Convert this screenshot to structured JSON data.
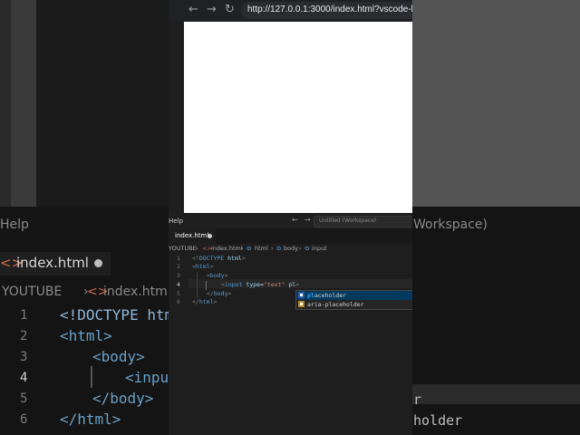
{
  "browser": {
    "back": "←",
    "forward": "→",
    "reload": "↻",
    "url": "http://127.0.0.1:3000/index.html?vscode-liv"
  },
  "vscode": {
    "menu_help": "Help",
    "command_center": "Untitled (Workspace)",
    "nav_back": "←",
    "nav_forward": "→",
    "tab": {
      "label": "index.html"
    },
    "breadcrumb": [
      "YOUTUBE",
      "index.html",
      "html",
      "body",
      "input"
    ],
    "lines": [
      {
        "no": "1",
        "doctype_open": "<!",
        "doctype_kw": "DOCTYPE",
        "doctype_val": " html",
        "doctype_close": ">"
      },
      {
        "no": "2",
        "open": "<",
        "name": "html",
        "close": ">"
      },
      {
        "no": "3",
        "open": "<",
        "name": "body",
        "close": ">"
      },
      {
        "no": "4",
        "open": "<",
        "name": "input",
        "attr": " type",
        "eq": "=",
        "val": "\"text\"",
        "typed": " pl",
        "close": ">"
      },
      {
        "no": "5",
        "open": "</",
        "name": "body",
        "close": ">"
      },
      {
        "no": "6",
        "open": "</",
        "name": "html",
        "close": ">"
      }
    ],
    "suggestions": [
      {
        "match": "pl",
        "rest": "aceholder",
        "selected": true
      },
      {
        "match": "",
        "rest": "aria-placeholder",
        "selected": false
      }
    ]
  },
  "background": {
    "help": "Help",
    "workspace": "Workspace)",
    "tab_label": "index.html",
    "breadcrumb_root": "YOUTUBE",
    "breadcrumb_file": "index.html",
    "line_numbers": [
      "1",
      "2",
      "3",
      "4",
      "5",
      "6"
    ],
    "line1": "<!DOCTYPE htm",
    "line2": "<html>",
    "line3": "<body>",
    "line4": "<inpu",
    "line5": "</body>",
    "line6": "</html>",
    "suggest_fragment": "r",
    "suggest_fragment2": "holder"
  },
  "colors": {
    "accent": "#2aaaff",
    "tag": "#569cd6",
    "attr": "#9cdcfe",
    "string": "#ce9178",
    "html_icon": "#d46a4e"
  }
}
